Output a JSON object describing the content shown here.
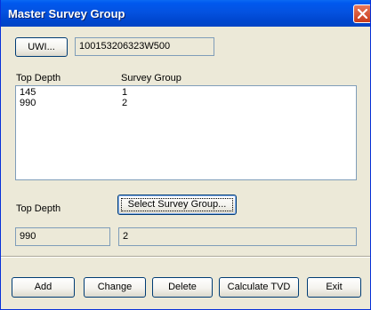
{
  "window": {
    "title": "Master Survey Group"
  },
  "uwi": {
    "button_label": "UWI...",
    "value": "100153206323W500"
  },
  "list": {
    "headers": [
      "Top Depth",
      "Survey Group"
    ],
    "rows": [
      {
        "top_depth": "145",
        "survey_group": "1"
      },
      {
        "top_depth": "990",
        "survey_group": "2"
      }
    ]
  },
  "edit": {
    "top_depth_label": "Top Depth",
    "select_button_label": "Select Survey Group...",
    "top_depth_value": "990",
    "survey_group_value": "2"
  },
  "buttons": {
    "add": "Add",
    "change": "Change",
    "delete": "Delete",
    "calculate": "Calculate TVD",
    "exit": "Exit"
  },
  "icons": {
    "close": "close-icon"
  },
  "colors": {
    "titlebar": "#0058ee",
    "close": "#c83c1c",
    "dialog_bg": "#ece9d8"
  }
}
